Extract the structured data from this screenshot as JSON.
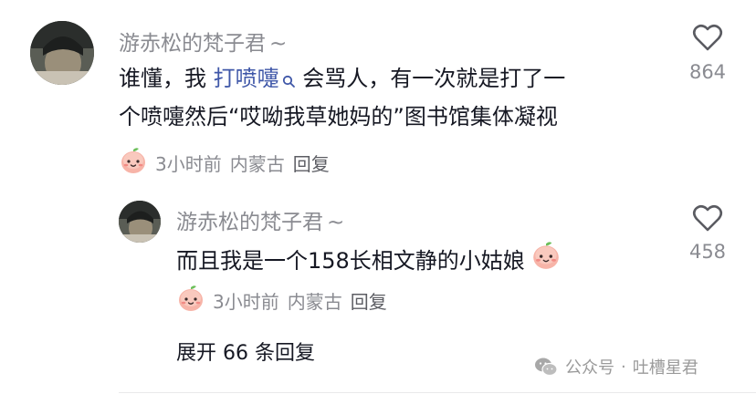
{
  "comment": {
    "username": "游赤松的梵子君",
    "username_suffix": "~",
    "text_before": "谁懂，我 ",
    "search_link": "打喷嚏",
    "text_line1_after": " 会骂人，有一次就是打了一",
    "text_line2": "个喷嚏然后“哎呦我草她妈的”图书馆集体凝视",
    "time": "3小时前",
    "location": "内蒙古",
    "reply_label": "回复",
    "like_count": "864"
  },
  "reply": {
    "username": "游赤松的梵子君",
    "username_suffix": "~",
    "text": "而且我是一个158长相文静的小姑娘",
    "time": "3小时前",
    "location": "内蒙古",
    "reply_label": "回复",
    "like_count": "458"
  },
  "expand_replies": "展开 66 条回复",
  "watermark": {
    "prefix": "公众号",
    "separator": "·",
    "name": "吐槽星君"
  },
  "colors": {
    "text": "#161823",
    "secondary": "#8a8b91",
    "link": "#3f57a8",
    "peach": "#f4a79b"
  },
  "icons": [
    "heart-outline-icon",
    "search-icon",
    "peach-emoji-icon",
    "wechat-icon"
  ]
}
